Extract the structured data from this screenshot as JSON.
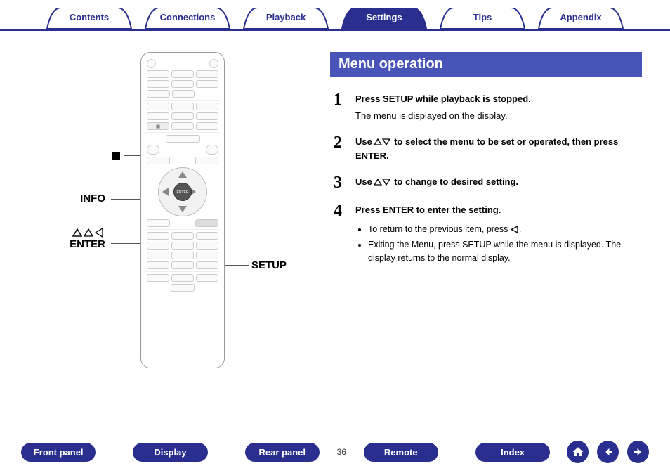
{
  "topnav": {
    "tabs": [
      {
        "label": "Contents",
        "active": false
      },
      {
        "label": "Connections",
        "active": false
      },
      {
        "label": "Playback",
        "active": false
      },
      {
        "label": "Settings",
        "active": true
      },
      {
        "label": "Tips",
        "active": false
      },
      {
        "label": "Appendix",
        "active": false
      }
    ]
  },
  "callouts": {
    "stop": "■",
    "info": "INFO",
    "enter_symbols": "△▽◁",
    "enter": "ENTER",
    "setup": "SETUP"
  },
  "section": {
    "title": "Menu operation"
  },
  "steps": [
    {
      "num": "1",
      "text": "Press SETUP while playback is stopped.",
      "sub": "The menu is displayed on the display."
    },
    {
      "num": "2",
      "text_before": "Use ",
      "text_after": " to select the menu to be set or operated, then press ENTER."
    },
    {
      "num": "3",
      "text_before": "Use ",
      "text_after": " to change to desired setting."
    },
    {
      "num": "4",
      "text": "Press ENTER to enter the setting.",
      "bullets": [
        {
          "before": "To return to the previous item, press ",
          "after": "."
        },
        {
          "text": "Exiting the Menu, press SETUP while the menu is displayed. The display returns to the normal display."
        }
      ]
    }
  ],
  "bottom": {
    "front_panel": "Front panel",
    "display": "Display",
    "rear_panel": "Rear panel",
    "page": "36",
    "remote": "Remote",
    "index": "Index"
  }
}
